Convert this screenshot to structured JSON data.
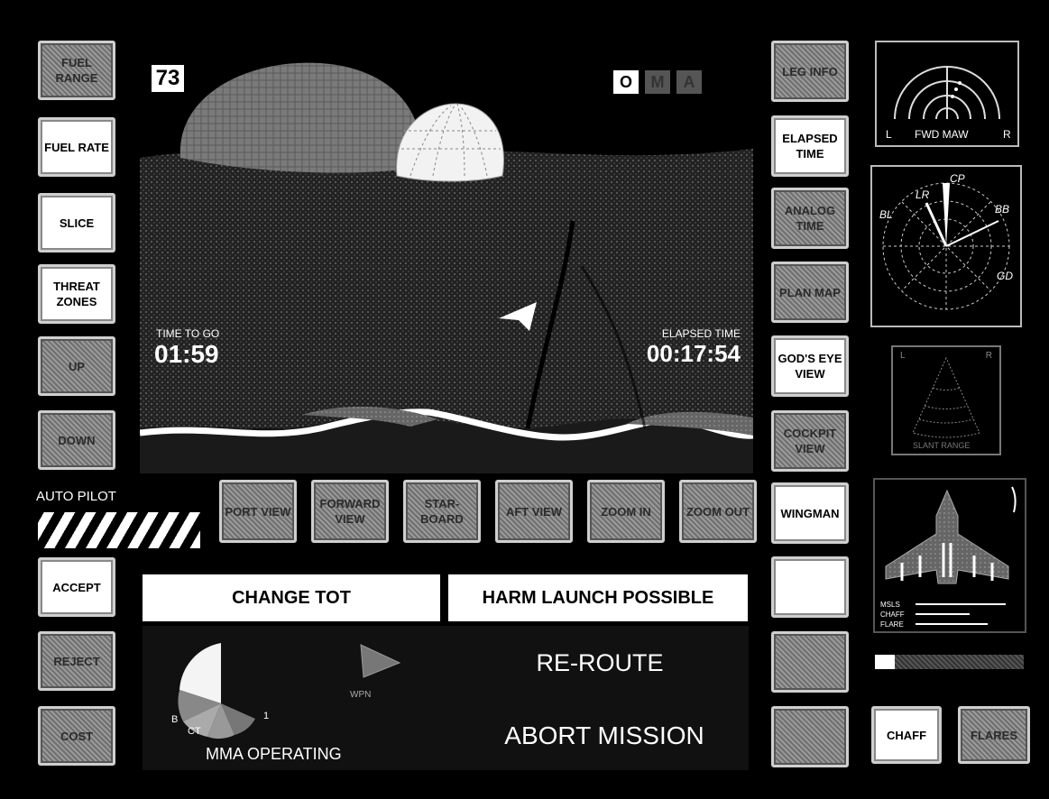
{
  "altitude_badge": "73",
  "mode_buttons": [
    {
      "label": "O",
      "state": "active"
    },
    {
      "label": "M",
      "state": "inactive"
    },
    {
      "label": "A",
      "state": "inactive"
    }
  ],
  "left_buttons": [
    {
      "label": "FUEL RANGE",
      "state": "dim"
    },
    {
      "label": "FUEL RATE",
      "state": "lit"
    },
    {
      "label": "SLICE",
      "state": "lit"
    },
    {
      "label": "THREAT ZONES",
      "state": "lit"
    },
    {
      "label": "UP",
      "state": "dim"
    },
    {
      "label": "DOWN",
      "state": "dim"
    }
  ],
  "auto_pilot": {
    "label": "AUTO PILOT"
  },
  "view_buttons": [
    {
      "label": "PORT VIEW"
    },
    {
      "label": "FORWARD VIEW"
    },
    {
      "label": "STAR-BOARD"
    },
    {
      "label": "AFT VIEW"
    },
    {
      "label": "ZOOM IN"
    },
    {
      "label": "ZOOM OUT"
    }
  ],
  "bottom_left_buttons": [
    {
      "label": "ACCEPT",
      "state": "lit"
    },
    {
      "label": "REJECT",
      "state": "dim"
    },
    {
      "label": "COST",
      "state": "dim"
    }
  ],
  "right_buttons": [
    {
      "label": "LEG INFO",
      "state": "dim"
    },
    {
      "label": "ELAPSED TIME",
      "state": "lit"
    },
    {
      "label": "ANALOG TIME",
      "state": "dim"
    },
    {
      "label": "PLAN MAP",
      "state": "dim"
    },
    {
      "label": "GOD'S EYE VIEW",
      "state": "lit"
    },
    {
      "label": "COCKPIT VIEW",
      "state": "dim"
    },
    {
      "label": "WINGMAN",
      "state": "lit"
    },
    {
      "label": "",
      "state": "lit"
    },
    {
      "label": "",
      "state": "dim"
    },
    {
      "label": "",
      "state": "dim"
    }
  ],
  "scene": {
    "time_to_go_label": "TIME TO GO",
    "time_to_go": "01:59",
    "elapsed_label": "ELAPSED TIME",
    "elapsed": "00:17:54"
  },
  "messages": {
    "change_tot": "CHANGE TOT",
    "harm": "HARM LAUNCH POSSIBLE",
    "reroute": "RE-ROUTE",
    "abort": "ABORT MISSION",
    "mma": "MMA OPERATING"
  },
  "pie_chart": {
    "labels": [
      "B",
      "CT",
      "1"
    ],
    "small_label": "WPN"
  },
  "radar": {
    "left": "L",
    "title": "FWD MAW",
    "right": "R"
  },
  "rwr": {
    "labels": [
      "LR",
      "CP",
      "BL",
      "BB",
      "GD"
    ]
  },
  "cone": {
    "left": "L",
    "right": "R",
    "caption": "SLANT RANGE"
  },
  "aircraft_status": {
    "rows": [
      "MSLS",
      "CHAFF",
      "FLARE"
    ]
  },
  "countermeasures": {
    "chaff": "CHAFF",
    "flares": "FLARES"
  }
}
